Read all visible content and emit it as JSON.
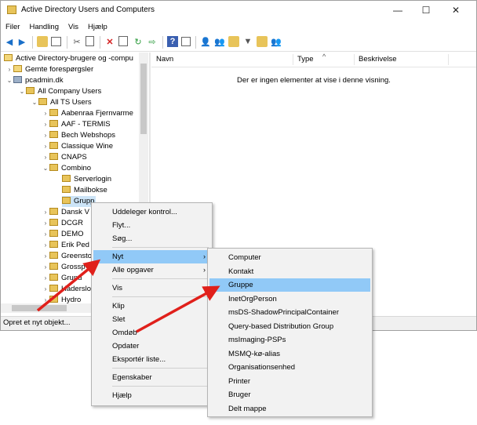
{
  "window": {
    "title": "Active Directory Users and Computers",
    "controls": {
      "minimize": "—",
      "maximize": "☐",
      "close": "✕"
    }
  },
  "menubar": [
    "Filer",
    "Handling",
    "Vis",
    "Hjælp"
  ],
  "toolbar": {
    "icons": [
      "back-arrow-icon",
      "forward-arrow-icon",
      "up-folder-icon",
      "console-tree-icon",
      "cut-icon",
      "copy-icon",
      "delete-icon",
      "properties-icon",
      "refresh-icon",
      "export-icon",
      "help-icon",
      "mmc-icon",
      "new-user-icon",
      "new-group-icon",
      "new-ou-icon",
      "filter-icon",
      "find-icon",
      "add-to-group-icon"
    ]
  },
  "tree": {
    "root": "Active Directory-brugere og -compu",
    "saved_queries": "Gemte forespørgsler",
    "domain": "pcadmin.dk",
    "all_company_users": "All Company Users",
    "all_ts_users": "All TS Users",
    "ous": [
      "Aabenraa Fjernvarme",
      "AAF - TERMIS",
      "Bech Webshops",
      "Classique Wine",
      "CNAPS",
      "Combino"
    ],
    "combino_children": [
      "Serverlogin",
      "Mailbokse",
      "Grupp"
    ],
    "after": [
      "Dansk V",
      "DCGR",
      "DEMO",
      "Erik Ped",
      "Greensto",
      "Grossp",
      "Grund",
      "Haderslo",
      "Hydro"
    ]
  },
  "list": {
    "columns": [
      "Navn",
      "Type",
      "Beskrivelse"
    ],
    "sort_glyph": "^",
    "empty_message": "Der er ingen elementer at vise i denne visning."
  },
  "status_bar": "Opret et nyt objekt...",
  "context_menu": {
    "items": [
      "Uddeleger kontrol...",
      "Flyt...",
      "Søg...",
      "Nyt",
      "Alle opgaver",
      "Vis",
      "Klip",
      "Slet",
      "Omdøb",
      "Opdater",
      "Eksportér liste...",
      "Egenskaber",
      "Hjælp"
    ],
    "submenu_arrow": "›"
  },
  "new_submenu": {
    "items": [
      "Computer",
      "Kontakt",
      "Gruppe",
      "InetOrgPerson",
      "msDS-ShadowPrincipalContainer",
      "Query-based Distribution Group",
      "msImaging-PSPs",
      "MSMQ-kø-alias",
      "Organisationsenhed",
      "Printer",
      "Bruger",
      "Delt mappe"
    ],
    "highlighted": "Gruppe"
  },
  "colors": {
    "menu_highlight": "#91c9f7",
    "tree_selection": "#cce4f7",
    "annotation_arrow": "#e0201b",
    "folder": "#e8c45a"
  }
}
